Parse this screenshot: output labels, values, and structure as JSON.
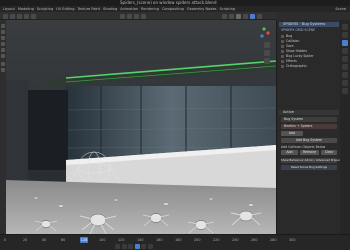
{
  "window": {
    "title": "Spiders_(scene) on window spiders attack.blend"
  },
  "menu": {
    "items": [
      "Layout",
      "Modeling",
      "Sculpting",
      "UV Editing",
      "Texture Paint",
      "Shading",
      "Animation",
      "Rendering",
      "Compositing",
      "Geometry Nodes",
      "Scripting"
    ],
    "scene": "Scene"
  },
  "panel": {
    "header": "SPIDERS · Bug Systems",
    "subheader": "SPIDERY GRID SCENE",
    "options": [
      "Bug",
      "Collision",
      "Gore",
      "Show Hidden",
      "Bug Lucky Spider",
      "Effects",
      "Orthographic"
    ],
    "section": "Active",
    "field1": "Bug System",
    "field2": "Beetles + Spiders",
    "add_button": "Add",
    "system_button": "Add Bug System",
    "label_a": "Add Collision Objects Below",
    "btn_a": "Add",
    "btn_b": "Remove",
    "btn_c": "Clear",
    "footer_button": "Show Behaviour Admin / Advanced Properties",
    "footer2": "Reset Scene Bug Settings"
  },
  "timeline": {
    "ticks": [
      "0",
      "20",
      "40",
      "60",
      "80",
      "100",
      "120",
      "140",
      "160",
      "180",
      "200",
      "220",
      "240",
      "260",
      "280",
      "300"
    ],
    "current_frame": "128"
  },
  "colors": {
    "accent": "#4d7fd1",
    "green_light": "#56d36a",
    "panel_bg": "#2a2a2a"
  },
  "icons": [
    "play-icon",
    "pause-icon",
    "skip-start-icon",
    "skip-end-icon",
    "step-forward-icon",
    "step-back-icon",
    "camera-icon",
    "render-icon",
    "gear-icon"
  ]
}
